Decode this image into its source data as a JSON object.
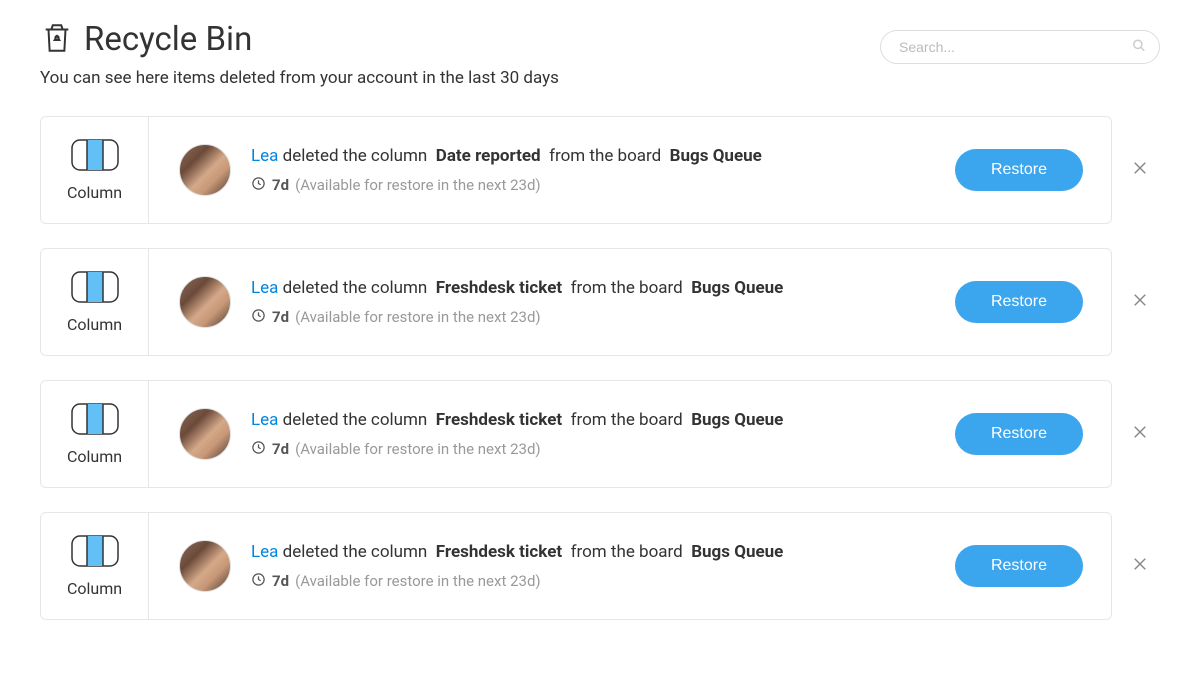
{
  "header": {
    "title": "Recycle Bin",
    "subtitle": "You can see here items deleted from your account in the last 30 days"
  },
  "search": {
    "placeholder": "Search..."
  },
  "labels": {
    "restore": "Restore",
    "deleted_the_column": "deleted the column",
    "from_the_board": "from the board"
  },
  "items": [
    {
      "type_label": "Column",
      "user": "Lea",
      "subject": "Date reported",
      "board": "Bugs Queue",
      "age": "7d",
      "availability": "(Available for restore in the next 23d)"
    },
    {
      "type_label": "Column",
      "user": "Lea",
      "subject": "Freshdesk ticket",
      "board": "Bugs Queue",
      "age": "7d",
      "availability": "(Available for restore in the next 23d)"
    },
    {
      "type_label": "Column",
      "user": "Lea",
      "subject": "Freshdesk ticket",
      "board": "Bugs Queue",
      "age": "7d",
      "availability": "(Available for restore in the next 23d)"
    },
    {
      "type_label": "Column",
      "user": "Lea",
      "subject": "Freshdesk ticket",
      "board": "Bugs Queue",
      "age": "7d",
      "availability": "(Available for restore in the next 23d)"
    }
  ]
}
